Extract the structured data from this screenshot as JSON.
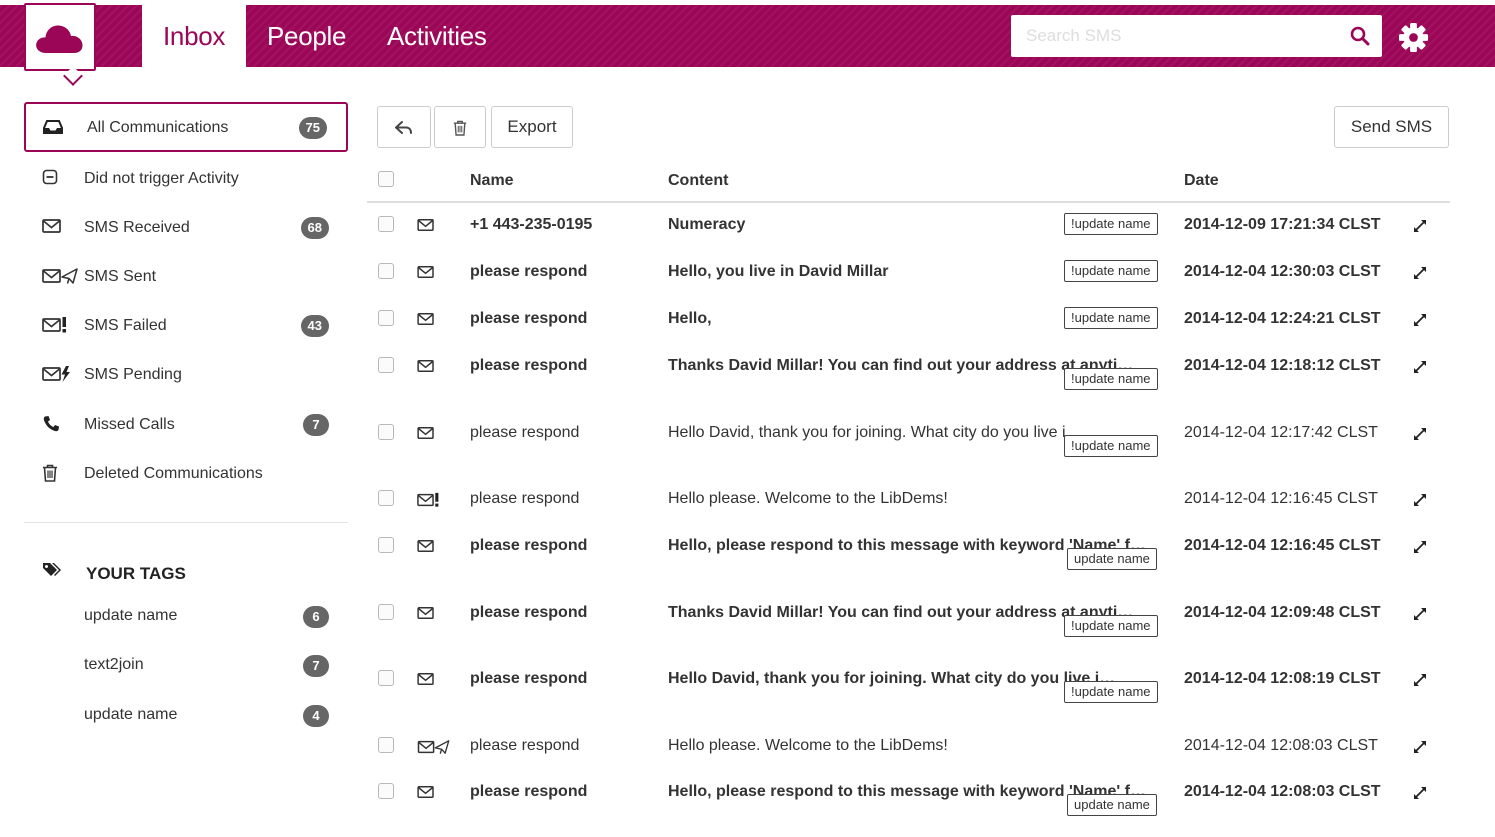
{
  "header": {
    "tabs": [
      {
        "label": "Inbox"
      },
      {
        "label": "People"
      },
      {
        "label": "Activities"
      }
    ],
    "search_placeholder": "Search SMS",
    "brand_color": "#9b0657"
  },
  "sidebar": {
    "items": [
      {
        "label": "All Communications",
        "count": "75",
        "icon": "inbox-icon"
      },
      {
        "label": "Did not trigger Activity",
        "icon": "minus-square-icon"
      },
      {
        "label": "SMS Received",
        "count": "68",
        "icon": "envelope-icon"
      },
      {
        "label": "SMS Sent",
        "icon": "envelope-sent-icon"
      },
      {
        "label": "SMS Failed",
        "count": "43",
        "icon": "envelope-failed-icon"
      },
      {
        "label": "SMS Pending",
        "icon": "envelope-pending-icon"
      },
      {
        "label": "Missed Calls",
        "count": "7",
        "icon": "phone-icon"
      },
      {
        "label": "Deleted Communications",
        "icon": "trash-icon"
      }
    ],
    "tags_heading": "YOUR TAGS",
    "tags": [
      {
        "label": "update name",
        "count": "6"
      },
      {
        "label": "text2join",
        "count": "7"
      },
      {
        "label": "update name",
        "count": "4"
      }
    ]
  },
  "toolbar": {
    "export_label": "Export",
    "send_label": "Send SMS"
  },
  "table": {
    "headers": {
      "name": "Name",
      "content": "Content",
      "date": "Date"
    },
    "rows": [
      {
        "name": "+1 443-235-0195",
        "content": "Numeracy",
        "tag": "!update name",
        "date": "2014-12-09 17:21:34 CLST",
        "icon": "envelope-icon",
        "bold": true
      },
      {
        "name": "please respond",
        "content": "Hello, you live in David Millar",
        "tag": "!update name",
        "date": "2014-12-04 12:30:03 CLST",
        "icon": "envelope-icon",
        "bold": true
      },
      {
        "name": "please respond",
        "content": "Hello,",
        "tag": "!update name",
        "date": "2014-12-04 12:24:21 CLST",
        "icon": "envelope-icon",
        "bold": true
      },
      {
        "name": "please respond",
        "content": "Thanks David Millar! You can find out your address at anyti…",
        "tag": "!update name",
        "date": "2014-12-04 12:18:12 CLST",
        "icon": "envelope-icon",
        "bold": true
      },
      {
        "name": "please respond",
        "content": "Hello David, thank you for joining. What city do you live i…",
        "tag": "!update name",
        "date": "2014-12-04 12:17:42 CLST",
        "icon": "envelope-icon",
        "bold": false
      },
      {
        "name": "please respond",
        "content": "Hello please. Welcome to the LibDems!",
        "tag": "",
        "date": "2014-12-04 12:16:45 CLST",
        "icon": "envelope-failed-icon",
        "bold": false
      },
      {
        "name": "please respond",
        "content": "Hello, please respond to this message with keyword 'Name' f…",
        "tag": "update name",
        "date": "2014-12-04 12:16:45 CLST",
        "icon": "envelope-icon",
        "bold": true
      },
      {
        "name": "please respond",
        "content": "Thanks David Millar! You can find out your address at anyti…",
        "tag": "!update name",
        "date": "2014-12-04 12:09:48 CLST",
        "icon": "envelope-icon",
        "bold": true
      },
      {
        "name": "please respond",
        "content": "Hello David, thank you for joining. What city do you live i…",
        "tag": "!update name",
        "date": "2014-12-04 12:08:19 CLST",
        "icon": "envelope-icon",
        "bold": true
      },
      {
        "name": "please respond",
        "content": "Hello please. Welcome to the LibDems!",
        "tag": "",
        "date": "2014-12-04 12:08:03 CLST",
        "icon": "envelope-sent-icon",
        "bold": false
      },
      {
        "name": "please respond",
        "content": "Hello, please respond to this message with keyword 'Name' f…",
        "tag": "update name",
        "date": "2014-12-04 12:08:03 CLST",
        "icon": "envelope-icon",
        "bold": true
      }
    ]
  }
}
